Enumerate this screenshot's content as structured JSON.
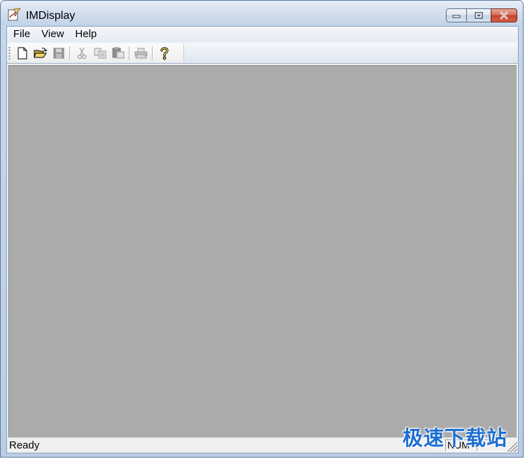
{
  "window": {
    "title": "IMDisplay",
    "app_icon": "imdisplay-app-icon"
  },
  "caption_buttons": {
    "minimize_icon": "minimize-icon",
    "maximize_icon": "maximize-icon",
    "close_icon": "close-icon"
  },
  "menubar": {
    "items": [
      {
        "label": "File"
      },
      {
        "label": "View"
      },
      {
        "label": "Help"
      }
    ]
  },
  "toolbar": {
    "buttons": [
      {
        "icon": "new-file-icon",
        "enabled": true
      },
      {
        "icon": "open-folder-icon",
        "enabled": true
      },
      {
        "icon": "save-icon",
        "enabled": false
      },
      {
        "icon": "cut-icon",
        "enabled": false
      },
      {
        "icon": "copy-icon",
        "enabled": false
      },
      {
        "icon": "paste-icon",
        "enabled": false
      },
      {
        "icon": "print-icon",
        "enabled": false
      },
      {
        "icon": "help-icon",
        "enabled": true
      }
    ]
  },
  "canvas": {
    "background_color": "#ababab"
  },
  "statusbar": {
    "status_text": "Ready",
    "num_indicator": "NUM",
    "scrl_indicator": ""
  },
  "watermark": {
    "text": "极速下载站",
    "color": "#1e6fd2"
  }
}
